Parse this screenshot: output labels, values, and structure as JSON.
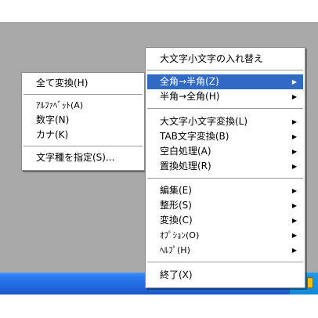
{
  "main_menu": {
    "items": [
      {
        "label": "大文字小文字の入れ替え",
        "arrow": ""
      },
      {
        "label": "全角→半角(Z)",
        "arrow": "▶",
        "highlighted": true
      },
      {
        "label": "半角→全角(H)",
        "arrow": "▶"
      },
      {
        "label": "大文字小文字変換(L)",
        "arrow": "▶"
      },
      {
        "label": "TAB文字変換(B)",
        "arrow": "▶"
      },
      {
        "label": "空白処理(A)",
        "arrow": "▶"
      },
      {
        "label": "置換処理(R)",
        "arrow": "▶"
      },
      {
        "label": "編集(E)",
        "arrow": "▶"
      },
      {
        "label": "整形(S)",
        "arrow": "▶"
      },
      {
        "label": "変換(C)",
        "arrow": "▶"
      },
      {
        "label": "ｵﾌﾟｼｮﾝ(O)",
        "arrow": "▶"
      },
      {
        "label": "ﾍﾙﾌﾟ(H)",
        "arrow": "▶"
      },
      {
        "label": "終了(X)",
        "arrow": ""
      }
    ]
  },
  "submenu": {
    "items": [
      {
        "label": "全て変換(H)"
      },
      {
        "label": "ｱﾙﾌｧﾍﾞｯﾄ(A)"
      },
      {
        "label": "数字(N)"
      },
      {
        "label": "カナ(K)"
      },
      {
        "label": "文字種を指定(S)..."
      }
    ]
  },
  "tray": {
    "icons": [
      "tray-app-icon",
      "tray-notify-icon"
    ]
  }
}
